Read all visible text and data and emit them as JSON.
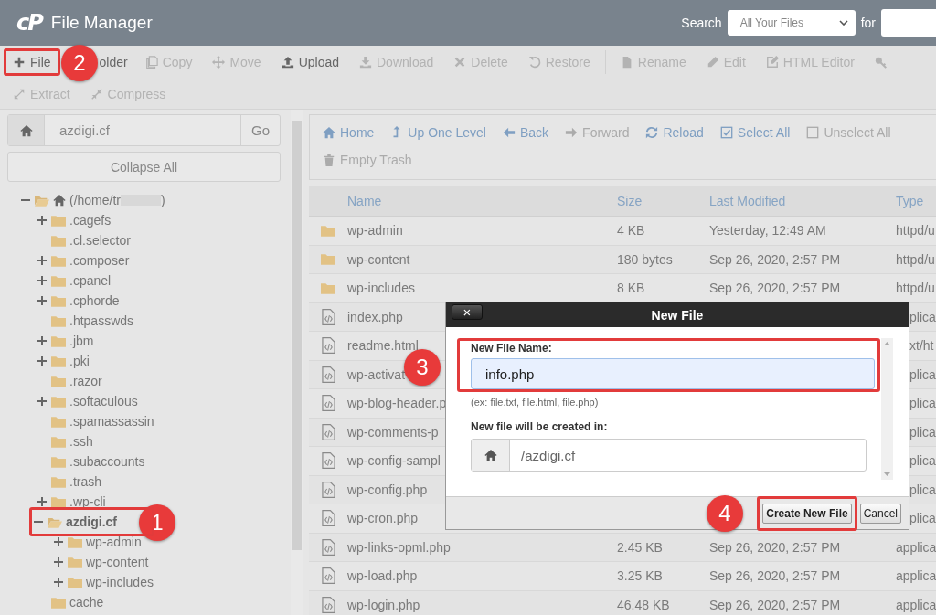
{
  "header": {
    "logo": "cP",
    "title": "File Manager",
    "search_label": "Search",
    "search_scope": "All Your Files",
    "for_label": "for"
  },
  "toolbar": [
    {
      "label": "File",
      "disabled": false,
      "highlighted": true
    },
    {
      "label": "older",
      "disabled": false,
      "highlighted": false
    },
    {
      "label": "Copy",
      "disabled": true,
      "highlighted": false
    },
    {
      "label": "Move",
      "disabled": true,
      "highlighted": false
    },
    {
      "label": "Upload",
      "disabled": false,
      "highlighted": false
    },
    {
      "label": "Download",
      "disabled": true,
      "highlighted": false
    },
    {
      "label": "Delete",
      "disabled": true,
      "highlighted": false
    },
    {
      "label": "Restore",
      "disabled": true,
      "highlighted": false
    },
    {
      "label": "Rename",
      "disabled": true,
      "highlighted": false
    },
    {
      "label": "Edit",
      "disabled": true,
      "highlighted": false
    },
    {
      "label": "HTML Editor",
      "disabled": true,
      "highlighted": false
    },
    {
      "disabled": true,
      "highlighted": false
    },
    {
      "label": "Extract",
      "disabled": true,
      "highlighted": false
    },
    {
      "label": "Compress",
      "disabled": true,
      "highlighted": false
    }
  ],
  "sidebar": {
    "path_value": "azdigi.cf",
    "go_label": "Go",
    "collapse_label": "Collapse All",
    "tree": [
      {
        "kind": "home",
        "label": "(/home/tr",
        "suffix": ")",
        "redacted": true,
        "expanded": true,
        "highlighted": false,
        "children": [
          {
            "label": ".cagefs",
            "expanded": false,
            "expandable": true,
            "highlighted": false
          },
          {
            "label": ".cl.selector",
            "expanded": false,
            "expandable": false,
            "highlighted": false
          },
          {
            "label": ".composer",
            "expanded": false,
            "expandable": true,
            "highlighted": false
          },
          {
            "label": ".cpanel",
            "expanded": false,
            "expandable": true,
            "highlighted": false
          },
          {
            "label": ".cphorde",
            "expanded": false,
            "expandable": true,
            "highlighted": false
          },
          {
            "label": ".htpasswds",
            "expanded": false,
            "expandable": false,
            "highlighted": false
          },
          {
            "label": ".jbm",
            "expanded": false,
            "expandable": true,
            "highlighted": false
          },
          {
            "label": ".pki",
            "expanded": false,
            "expandable": true,
            "highlighted": false
          },
          {
            "label": ".razor",
            "expanded": false,
            "expandable": false,
            "highlighted": false
          },
          {
            "label": ".softaculous",
            "expanded": false,
            "expandable": true,
            "highlighted": false
          },
          {
            "label": ".spamassassin",
            "expanded": false,
            "expandable": false,
            "highlighted": false
          },
          {
            "label": ".ssh",
            "expanded": false,
            "expandable": false,
            "highlighted": false
          },
          {
            "label": ".subaccounts",
            "expanded": false,
            "expandable": false,
            "highlighted": false
          },
          {
            "label": ".trash",
            "expanded": false,
            "expandable": false,
            "highlighted": false
          },
          {
            "label": ".wp-cli",
            "expanded": false,
            "expandable": true,
            "highlighted": false
          },
          {
            "label": "azdigi.cf",
            "expanded": true,
            "expandable": true,
            "highlighted": true,
            "children": [
              {
                "label": "wp-admin",
                "expanded": false,
                "expandable": true,
                "highlighted": false
              },
              {
                "label": "wp-content",
                "expanded": false,
                "expandable": true,
                "highlighted": false
              },
              {
                "label": "wp-includes",
                "expanded": false,
                "expandable": true,
                "highlighted": false
              }
            ]
          },
          {
            "label": "cache",
            "expanded": false,
            "expandable": false,
            "highlighted": false
          }
        ]
      }
    ]
  },
  "nav": [
    {
      "label": "Home",
      "disabled": false
    },
    {
      "label": "Up One Level",
      "disabled": false
    },
    {
      "label": "Back",
      "disabled": false
    },
    {
      "label": "Forward",
      "disabled": true
    },
    {
      "label": "Reload",
      "disabled": false
    },
    {
      "label": "Select All",
      "disabled": false
    },
    {
      "label": "Unselect All",
      "disabled": true
    },
    {
      "label": "Empty Trash",
      "disabled": true
    }
  ],
  "table": {
    "columns": [
      "Name",
      "Size",
      "Last Modified",
      "Type"
    ],
    "rows": [
      {
        "kind": "folder",
        "name": "wp-admin",
        "size": "4 KB",
        "modified": "Yesterday, 12:49 AM",
        "type": "httpd/u"
      },
      {
        "kind": "folder",
        "name": "wp-content",
        "size": "180 bytes",
        "modified": "Sep 26, 2020, 2:57 PM",
        "type": "httpd/u"
      },
      {
        "kind": "folder",
        "name": "wp-includes",
        "size": "8 KB",
        "modified": "Sep 26, 2020, 2:57 PM",
        "type": "httpd/u"
      },
      {
        "kind": "file",
        "name": "index.php",
        "type": "plica",
        "covered": true
      },
      {
        "kind": "file",
        "name": "readme.html",
        "type": "xt/ht",
        "covered": true
      },
      {
        "kind": "file",
        "name": "wp-activat",
        "type": "plica",
        "covered": true
      },
      {
        "kind": "file",
        "name": "wp-blog-header.p",
        "type": "plica",
        "covered": true
      },
      {
        "kind": "file",
        "name": "wp-comments-p",
        "type": "plica",
        "covered": true
      },
      {
        "kind": "file",
        "name": "wp-config-sampl",
        "type": "plica",
        "covered": true
      },
      {
        "kind": "file",
        "name": "wp-config.php",
        "type": "plica",
        "covered": true
      },
      {
        "kind": "file",
        "name": "wp-cron.php",
        "type": "plica",
        "covered": true
      },
      {
        "kind": "file",
        "name": "wp-links-opml.php",
        "size": "2.45 KB",
        "modified": "Sep 26, 2020, 2:57 PM",
        "type": "applica"
      },
      {
        "kind": "file",
        "name": "wp-load.php",
        "size": "3.25 KB",
        "modified": "Sep 26, 2020, 2:57 PM",
        "type": "applica"
      },
      {
        "kind": "file",
        "name": "wp-login.php",
        "size": "46.48 KB",
        "modified": "Sep 26, 2020, 2:57 PM",
        "type": "applica"
      }
    ]
  },
  "dialog": {
    "title": "New File",
    "close_label": "×",
    "name_label": "New File Name:",
    "name_value": "info.php",
    "name_highlighted": true,
    "hint": "(ex: file.txt, file.html, file.php)",
    "location_label": "New file will be created in:",
    "location_value": "/azdigi.cf",
    "create_label": "Create New File",
    "create_highlighted": true,
    "cancel_label": "Cancel"
  },
  "callouts": [
    {
      "number": "1"
    },
    {
      "number": "2"
    },
    {
      "number": "3"
    },
    {
      "number": "4"
    }
  ]
}
